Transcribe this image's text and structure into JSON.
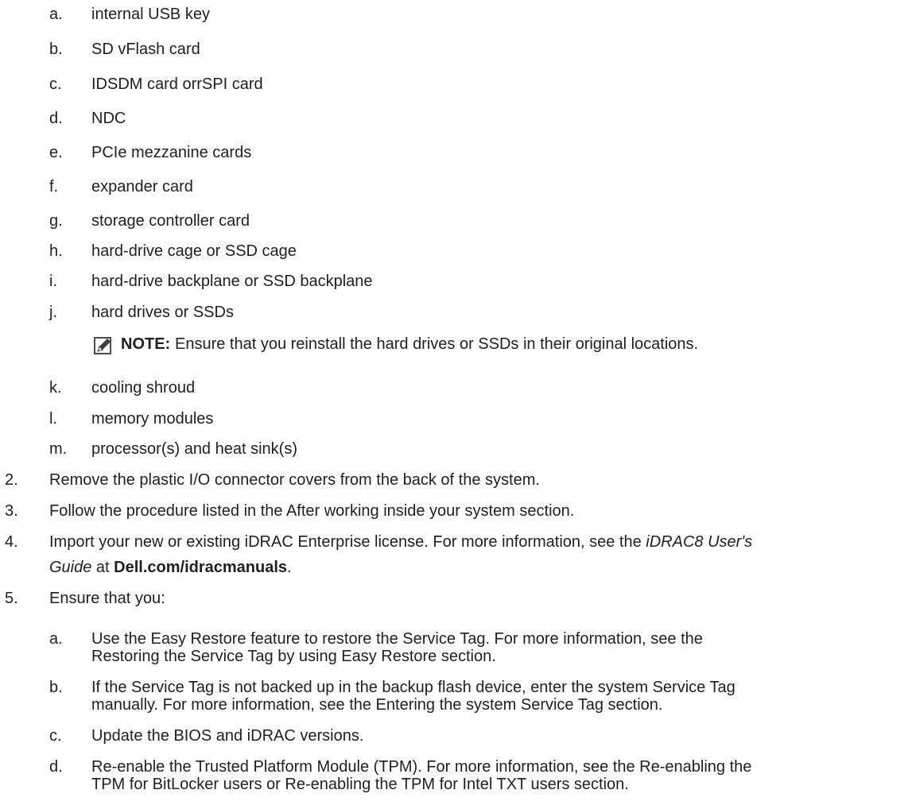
{
  "substeps_step1": [
    {
      "marker": "a.",
      "text": "internal USB key"
    },
    {
      "marker": "b.",
      "text": "SD vFlash card"
    },
    {
      "marker": "c.",
      "text": "IDSDM card orrSPI card"
    },
    {
      "marker": "d.",
      "text": "NDC"
    },
    {
      "marker": "e.",
      "text": "PCIe mezzanine cards"
    },
    {
      "marker": "f.",
      "text": "expander card"
    },
    {
      "marker": "g.",
      "text": "storage controller card"
    },
    {
      "marker": "h.",
      "text": "hard-drive cage or SSD cage"
    },
    {
      "marker": "i.",
      "text": "hard-drive backplane or SSD backplane"
    },
    {
      "marker": "j.",
      "text": "hard drives or SSDs"
    },
    {
      "marker": "k.",
      "text": "cooling shroud"
    },
    {
      "marker": "l.",
      "text": "memory modules"
    },
    {
      "marker": "m.",
      "text": "processor(s) and heat sink(s)"
    }
  ],
  "note": {
    "label": "NOTE:",
    "text": "Ensure that you reinstall the hard drives or SSDs in their original locations."
  },
  "steps": [
    {
      "marker": "2.",
      "text": "Remove the plastic I/O connector covers from the back of the system."
    },
    {
      "marker": "3.",
      "text": "Follow the procedure listed in the After working inside your system section."
    },
    {
      "marker": "4.",
      "text_before": "Import your new or existing iDRAC Enterprise license. For more information, see the ",
      "italic": "iDRAC8 User's",
      "italic2": "Guide",
      "text_mid": " at ",
      "bold_link": "Dell.com/idracmanuals",
      "text_after": "."
    },
    {
      "marker": "5.",
      "text": "Ensure that you:"
    }
  ],
  "substeps_step5": [
    {
      "marker": "a.",
      "line1": "Use the Easy Restore feature to restore the Service Tag. For more information, see the",
      "line2": "Restoring the Service Tag by using Easy Restore section."
    },
    {
      "marker": "b.",
      "line1": "If the Service Tag is not backed up in the backup flash device, enter the system Service Tag",
      "line2": "manually. For more information, see the Entering the system Service Tag section."
    },
    {
      "marker": "c.",
      "line1": "Update the BIOS and iDRAC versions.",
      "line2": ""
    },
    {
      "marker": "d.",
      "line1": "Re-enable the Trusted Platform Module (TPM). For more information, see the Re-enabling the",
      "line2": "TPM for BitLocker users or Re-enabling the TPM for Intel TXT users section."
    }
  ],
  "icons": {
    "note": "pencil-note-icon"
  }
}
